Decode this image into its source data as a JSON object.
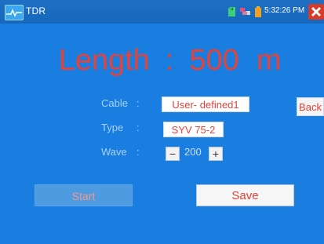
{
  "status_bar": {
    "app_title": "TDR",
    "clock": "5:32:26 PM",
    "icons": [
      "tdr-app-icon",
      "sd-card-icon",
      "network-icon",
      "battery-icon",
      "close-icon"
    ]
  },
  "readout": {
    "label": "Length",
    "separator": ":",
    "value": "500",
    "unit": "m"
  },
  "fields": {
    "cable_label": "Cable",
    "type_label": "Type",
    "wave_label": "Wave",
    "colon": ":"
  },
  "cable": {
    "value": "User- defined1"
  },
  "type": {
    "value": "SYV 75-2"
  },
  "wave": {
    "value": "200",
    "decrement": "−",
    "increment": "+"
  },
  "buttons": {
    "back": "Back",
    "start": "Start",
    "save": "Save"
  },
  "colors": {
    "background": "#1a7de0",
    "accent_red": "#e2433a",
    "label_blue": "#a9d2ff"
  }
}
